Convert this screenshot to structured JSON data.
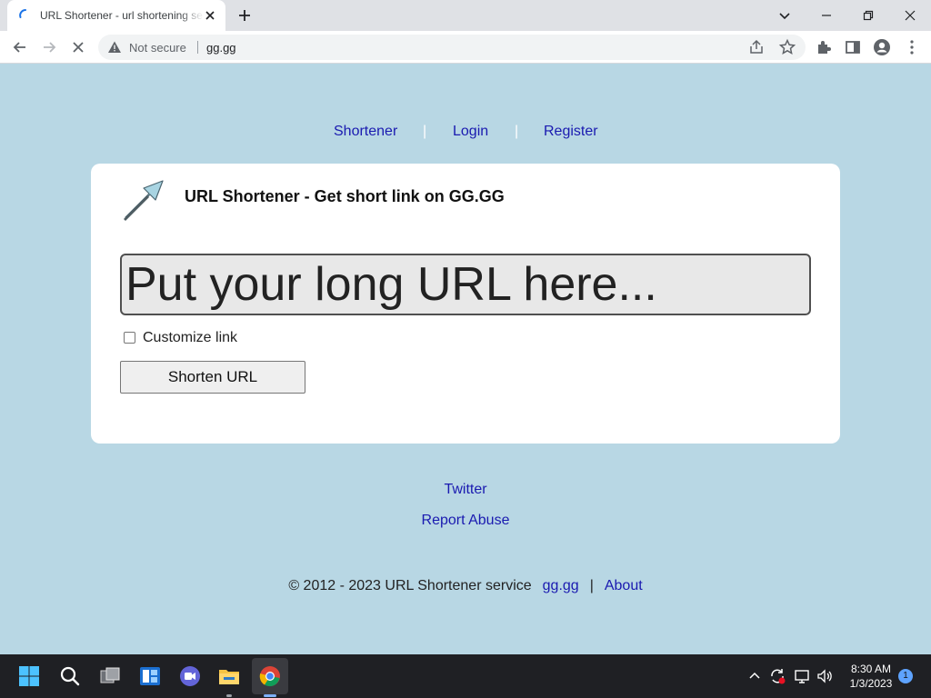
{
  "browser": {
    "tab": {
      "title": "URL Shortener - url shortening se"
    },
    "omnibox": {
      "security_label": "Not secure",
      "url": "gg.gg"
    }
  },
  "page": {
    "nav": [
      {
        "label": "Shortener"
      },
      {
        "label": "Login"
      },
      {
        "label": "Register"
      }
    ],
    "nav_separator": "|",
    "heading": "URL Shortener - Get short link on GG.GG",
    "url_input": {
      "placeholder": "Put your long URL here...",
      "value": ""
    },
    "customize": {
      "label": "Customize link",
      "checked": false
    },
    "shorten_button": "Shorten URL",
    "links": [
      {
        "label": "Twitter"
      },
      {
        "label": "Report Abuse"
      }
    ],
    "footer": {
      "copyright": "© 2012 - 2023 URL Shortener service",
      "link": "gg.gg",
      "separator": "|",
      "about": "About"
    }
  },
  "taskbar": {
    "time": "8:30 AM",
    "date": "1/3/2023",
    "notification_count": "1"
  },
  "colors": {
    "page_background": "#b8d7e4",
    "link": "#1a1ab0",
    "taskbar": "#1f2024"
  }
}
